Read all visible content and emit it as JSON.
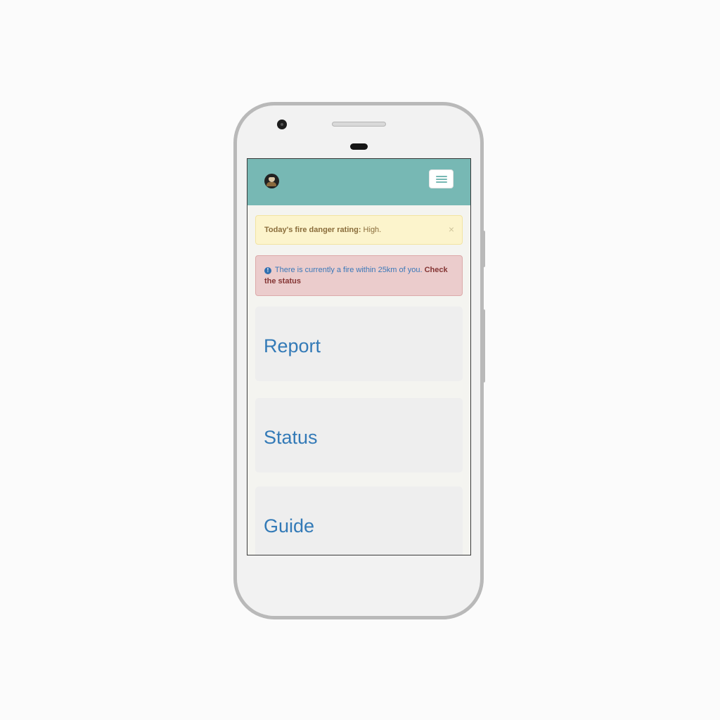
{
  "navbar": {
    "logo_icon": "fire-owl-logo-icon",
    "menu_icon": "hamburger-menu-icon",
    "background": "#77b8b4"
  },
  "alerts": {
    "warning": {
      "label": "Today's fire danger rating:",
      "value": " High.",
      "close": "×"
    },
    "danger": {
      "icon": "info-circle-icon",
      "icon_glyph": "!",
      "message": "There is currently a fire within 25km of you. ",
      "link": "Check the status"
    }
  },
  "tiles": [
    {
      "label": "Report"
    },
    {
      "label": "Status"
    },
    {
      "label": "Guide"
    }
  ],
  "colors": {
    "link_blue": "#337ab7",
    "warning_bg": "#fcf4cc",
    "danger_bg": "#ebcccc"
  }
}
